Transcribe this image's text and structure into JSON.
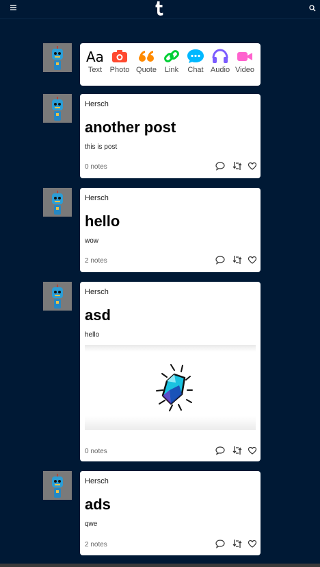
{
  "composer": {
    "types": [
      {
        "label": "Text",
        "icon": "text-icon",
        "color": "#000000"
      },
      {
        "label": "Photo",
        "icon": "camera-icon",
        "color": "#ff492f"
      },
      {
        "label": "Quote",
        "icon": "quote-icon",
        "color": "#ff8a00"
      },
      {
        "label": "Link",
        "icon": "link-icon",
        "color": "#00cf35"
      },
      {
        "label": "Chat",
        "icon": "chat-icon",
        "color": "#00b8ff"
      },
      {
        "label": "Audio",
        "icon": "headphones-icon",
        "color": "#7c5cff"
      },
      {
        "label": "Video",
        "icon": "video-camera-icon",
        "color": "#ff62ce"
      }
    ]
  },
  "posts": [
    {
      "blog": "Hersch",
      "title": "another post",
      "body": "this is post",
      "notes": "0 notes"
    },
    {
      "blog": "Hersch",
      "title": "hello",
      "body": "wow",
      "notes": "2 notes"
    },
    {
      "blog": "Hersch",
      "title": "asd",
      "body": "hello",
      "notes": "0 notes",
      "image": "gem-illustration"
    },
    {
      "blog": "Hersch",
      "title": "ads",
      "body": "qwe",
      "notes": "2 notes"
    }
  ],
  "colors": {
    "background": "#001935",
    "card": "#ffffff"
  }
}
